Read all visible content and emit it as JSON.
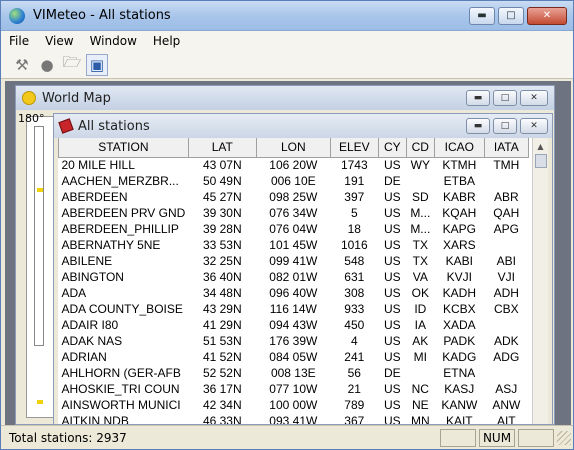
{
  "window": {
    "title": "VIMeteo - All stations"
  },
  "menu": [
    "File",
    "View",
    "Window",
    "Help"
  ],
  "toolbar": {
    "icons": [
      "wrench-icon",
      "bulb-icon",
      "folder-open-icon",
      "map-search-icon"
    ]
  },
  "world_map": {
    "title": "World Map",
    "axis_label": "180°"
  },
  "stations": {
    "title": "All stations",
    "columns": [
      "STATION",
      "LAT",
      "LON",
      "ELEV",
      "CY",
      "CD",
      "ICAO",
      "IATA"
    ],
    "rows": [
      [
        "20 MILE HILL",
        "43 07N",
        "106 20W",
        "1743",
        "US",
        "WY",
        "KTMH",
        "TMH"
      ],
      [
        "AACHEN_MERZBR...",
        "50 49N",
        "006 10E",
        "191",
        "DE",
        "",
        "ETBA",
        ""
      ],
      [
        "ABERDEEN",
        "45 27N",
        "098 25W",
        "397",
        "US",
        "SD",
        "KABR",
        "ABR"
      ],
      [
        "ABERDEEN PRV GND",
        "39 30N",
        "076 34W",
        "5",
        "US",
        "M...",
        "KQAH",
        "QAH"
      ],
      [
        "ABERDEEN_PHILLIP",
        "39 28N",
        "076 04W",
        "18",
        "US",
        "M...",
        "KAPG",
        "APG"
      ],
      [
        "ABERNATHY 5NE",
        "33 53N",
        "101 45W",
        "1016",
        "US",
        "TX",
        "XARS",
        ""
      ],
      [
        "ABILENE",
        "32 25N",
        "099 41W",
        "548",
        "US",
        "TX",
        "KABI",
        "ABI"
      ],
      [
        "ABINGTON",
        "36 40N",
        "082 01W",
        "631",
        "US",
        "VA",
        "KVJI",
        "VJI"
      ],
      [
        "ADA",
        "34 48N",
        "096 40W",
        "308",
        "US",
        "OK",
        "KADH",
        "ADH"
      ],
      [
        "ADA COUNTY_BOISE",
        "43 29N",
        "116 14W",
        "933",
        "US",
        "ID",
        "KCBX",
        "CBX"
      ],
      [
        "ADAIR I80",
        "41 29N",
        "094 43W",
        "450",
        "US",
        "IA",
        "XADA",
        ""
      ],
      [
        "ADAK NAS",
        "51 53N",
        "176 39W",
        "4",
        "US",
        "AK",
        "PADK",
        "ADK"
      ],
      [
        "ADRIAN",
        "41 52N",
        "084 05W",
        "241",
        "US",
        "MI",
        "KADG",
        "ADG"
      ],
      [
        "AHLHORN (GER-AFB",
        "52 52N",
        "008 13E",
        "56",
        "DE",
        "",
        "ETNA",
        ""
      ],
      [
        "AHOSKIE_TRI COUN",
        "36 17N",
        "077 10W",
        "21",
        "US",
        "NC",
        "KASJ",
        "ASJ"
      ],
      [
        "AINSWORTH MUNICI",
        "42 34N",
        "100 00W",
        "789",
        "US",
        "NE",
        "KANW",
        "ANW"
      ],
      [
        "AITKIN NDB",
        "46 33N",
        "093 41W",
        "367",
        "US",
        "MN",
        "KAIT",
        "AIT"
      ]
    ]
  },
  "status": {
    "text": "Total stations: 2937",
    "cells": [
      "",
      "NUM",
      ""
    ]
  }
}
